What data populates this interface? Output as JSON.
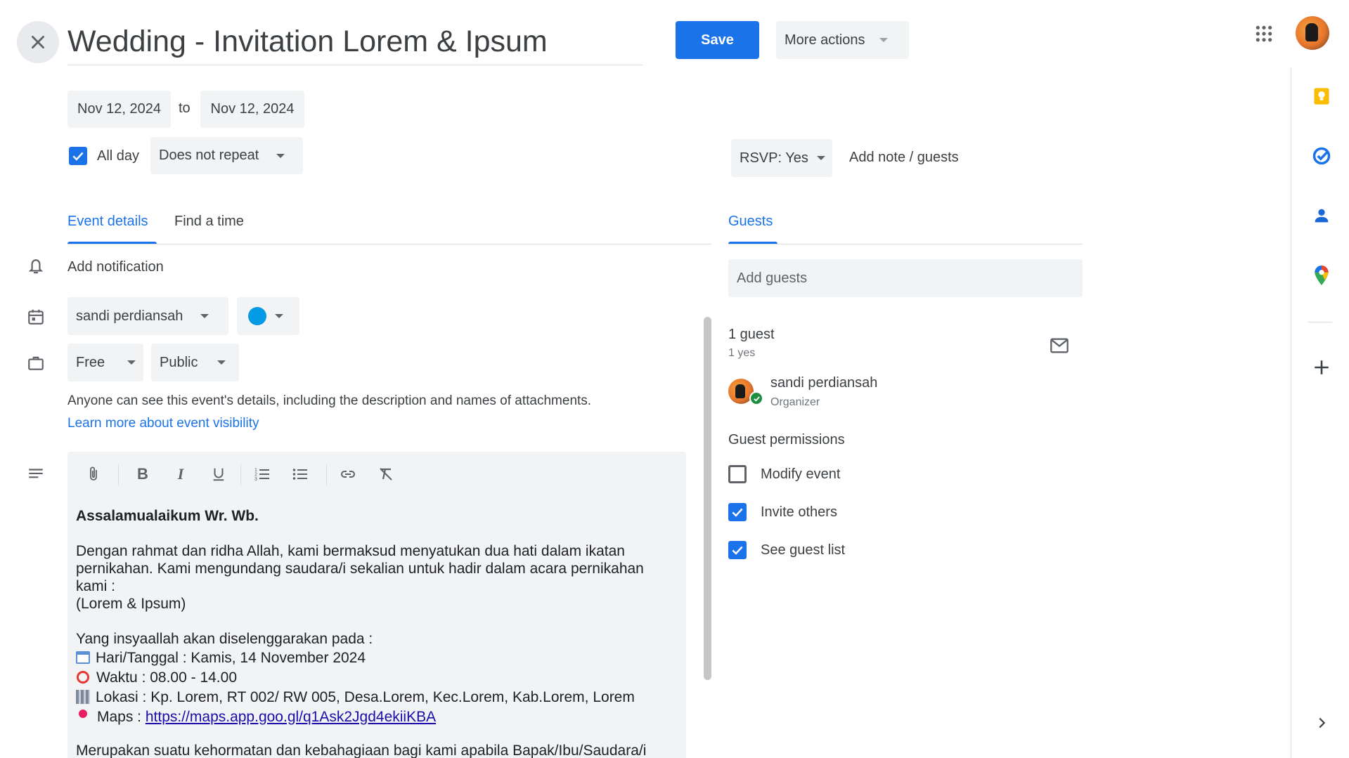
{
  "header": {
    "title": "Wedding - Invitation Lorem & Ipsum",
    "save_label": "Save",
    "more_actions_label": "More actions"
  },
  "dates": {
    "start": "Nov 12, 2024",
    "to": "to",
    "end": "Nov 12, 2024",
    "all_day_label": "All day",
    "all_day_checked": true,
    "repeat": "Does not repeat"
  },
  "rsvp": {
    "value": "RSVP: Yes",
    "add_note": "Add note / guests"
  },
  "tabs": {
    "event_details": "Event details",
    "find_time": "Find a time",
    "guests": "Guests"
  },
  "details": {
    "add_notification": "Add notification",
    "calendar": "sandi perdiansah",
    "calendar_color": "#039be5",
    "availability": "Free",
    "visibility": "Public",
    "visibility_note": "Anyone can see this event's details, including the description and names of attachments.",
    "learn_more": "Learn more about event visibility"
  },
  "description": {
    "greeting": "Assalamualaikum Wr. Wb.",
    "para1_line1": "Dengan rahmat dan ridha Allah, kami bermaksud menyatukan dua hati dalam ikatan",
    "para1_line2": "pernikahan. Kami mengundang saudara/i sekalian untuk hadir dalam acara pernikahan",
    "para1_line3": "kami :",
    "para1_line4": "(Lorem & Ipsum)",
    "schedule_intro": "Yang insyaallah akan diselenggarakan pada :",
    "date_line": "Hari/Tanggal : Kamis, 14 November 2024",
    "time_line": "Waktu : 08.00 - 14.00",
    "location_line": "Lokasi : Kp. Lorem, RT 002/ RW 005, Desa.Lorem, Kec.Lorem, Kab.Lorem, Lorem",
    "maps_label": "Maps : ",
    "maps_url": "https://maps.app.goo.gl/q1Ask2Jgd4ekiiKBA",
    "closing_partial": "Merupakan suatu kehormatan dan kebahagiaan bagi kami apabila Bapak/Ibu/Saudara/i"
  },
  "guests": {
    "add_placeholder": "Add guests",
    "count": "1 guest",
    "yes_count": "1 yes",
    "list": [
      {
        "name": "sandi perdiansah",
        "role": "Organizer"
      }
    ],
    "permissions_title": "Guest permissions",
    "permissions": [
      {
        "label": "Modify event",
        "checked": false
      },
      {
        "label": "Invite others",
        "checked": true
      },
      {
        "label": "See guest list",
        "checked": true
      }
    ]
  },
  "colors": {
    "accent": "#1a73e8",
    "keep_yellow": "#fbbc04",
    "tasks_blue": "#1a73e8",
    "contacts_blue": "#1967d2"
  }
}
